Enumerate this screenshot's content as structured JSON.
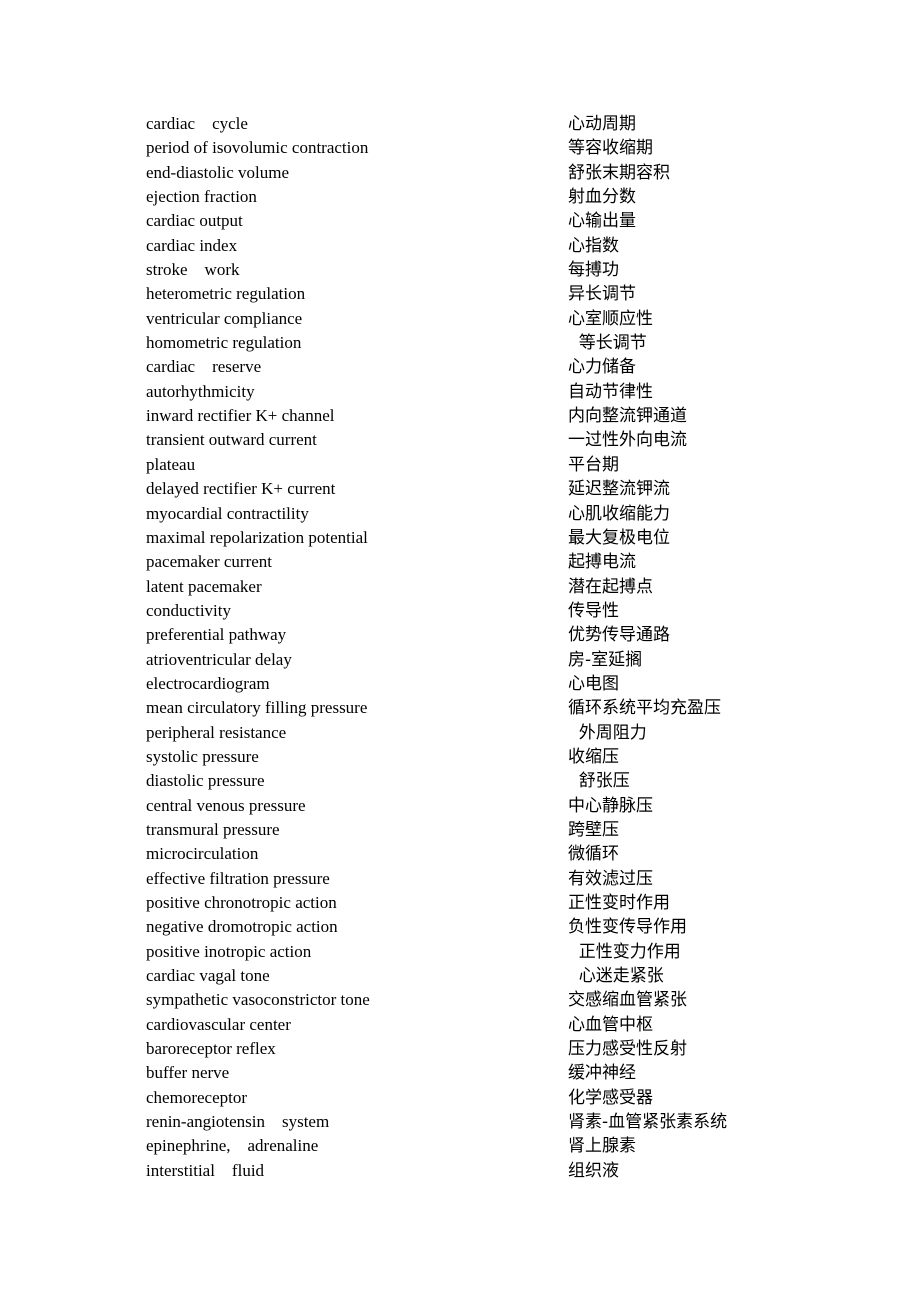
{
  "glossary": {
    "entries": [
      {
        "en": "cardiac    cycle",
        "zh": "心动周期"
      },
      {
        "en": "period of isovolumic contraction",
        "zh": "等容收缩期"
      },
      {
        "en": "end-diastolic volume",
        "zh": "舒张末期容积"
      },
      {
        "en": "ejection fraction",
        "zh": "射血分数"
      },
      {
        "en": "cardiac output",
        "zh": "心输出量"
      },
      {
        "en": "cardiac index",
        "zh": "心指数"
      },
      {
        "en": "stroke    work",
        "zh": "每搏功"
      },
      {
        "en": "heterometric regulation",
        "zh": "异长调节"
      },
      {
        "en": "ventricular compliance",
        "zh": "心室顺应性"
      },
      {
        "en": "homometric regulation",
        "zh": "  等长调节"
      },
      {
        "en": "cardiac    reserve",
        "zh": "心力储备"
      },
      {
        "en": "autorhythmicity",
        "zh": "自动节律性"
      },
      {
        "en": "inward rectifier K+ channel",
        "zh": "内向整流钾通道"
      },
      {
        "en": "transient outward current",
        "zh": "一过性外向电流"
      },
      {
        "en": "plateau",
        "zh": "平台期"
      },
      {
        "en": "delayed rectifier K+ current",
        "zh": "延迟整流钾流"
      },
      {
        "en": "myocardial contractility",
        "zh": "心肌收缩能力"
      },
      {
        "en": "maximal repolarization potential",
        "zh": "最大复极电位"
      },
      {
        "en": "pacemaker current",
        "zh": "起搏电流"
      },
      {
        "en": "latent pacemaker",
        "zh": "潜在起搏点"
      },
      {
        "en": "conductivity",
        "zh": "传导性"
      },
      {
        "en": "preferential pathway",
        "zh": "优势传导通路"
      },
      {
        "en": "atrioventricular delay",
        "zh": "房-室延搁"
      },
      {
        "en": "electrocardiogram",
        "zh": "心电图"
      },
      {
        "en": "mean circulatory filling pressure",
        "zh": "循环系统平均充盈压"
      },
      {
        "en": "peripheral resistance",
        "zh": "  外周阻力"
      },
      {
        "en": "systolic pressure",
        "zh": "收缩压"
      },
      {
        "en": "diastolic pressure",
        "zh": "  舒张压"
      },
      {
        "en": "central venous pressure",
        "zh": "中心静脉压"
      },
      {
        "en": "transmural pressure",
        "zh": "跨壁压"
      },
      {
        "en": "microcirculation",
        "zh": "微循环"
      },
      {
        "en": "effective filtration pressure",
        "zh": "有效滤过压"
      },
      {
        "en": "positive chronotropic action",
        "zh": "正性变时作用"
      },
      {
        "en": "negative dromotropic action",
        "zh": "负性变传导作用"
      },
      {
        "en": "positive inotropic action",
        "zh": "  正性变力作用"
      },
      {
        "en": "cardiac vagal tone",
        "zh": "  心迷走紧张"
      },
      {
        "en": "sympathetic vasoconstrictor tone",
        "zh": "交感缩血管紧张"
      },
      {
        "en": "cardiovascular center",
        "zh": "心血管中枢"
      },
      {
        "en": "baroreceptor reflex",
        "zh": "压力感受性反射"
      },
      {
        "en": "buffer nerve",
        "zh": "缓冲神经"
      },
      {
        "en": "chemoreceptor",
        "zh": "化学感受器"
      },
      {
        "en": "renin-angiotensin    system",
        "zh": "肾素-血管紧张素系统"
      },
      {
        "en": "epinephrine,    adrenaline",
        "zh": "肾上腺素"
      },
      {
        "en": "interstitial    fluid",
        "zh": "组织液"
      }
    ]
  }
}
